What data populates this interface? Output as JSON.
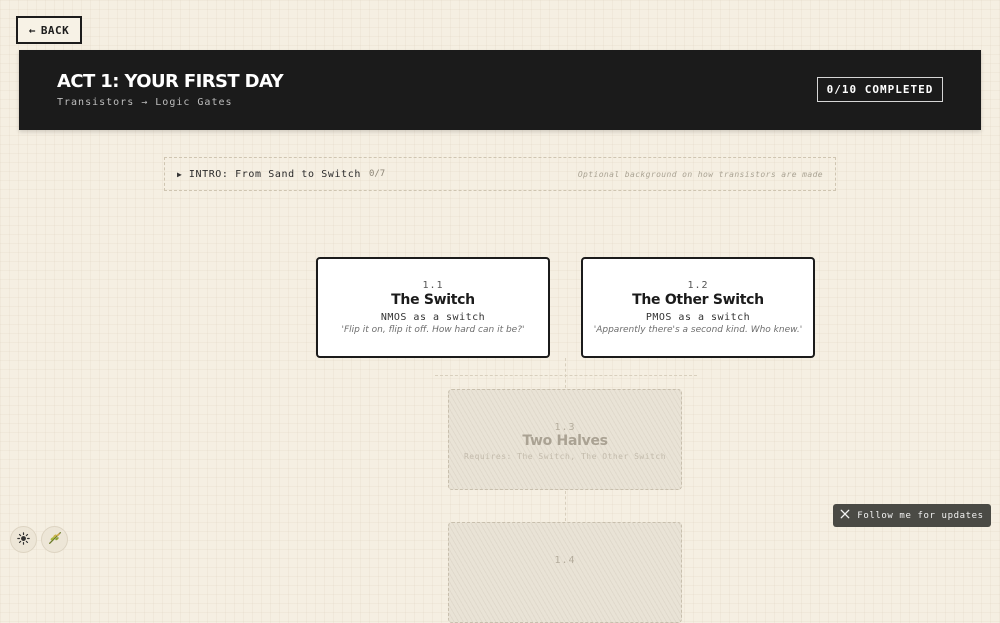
{
  "nav": {
    "back_label": "BACK",
    "back_arrow": "←"
  },
  "header": {
    "title": "ACT 1: YOUR FIRST DAY",
    "subtitle": "Transistors → Logic Gates",
    "progress": "0/10 COMPLETED"
  },
  "intro": {
    "caret": "▶",
    "title": "INTRO: From Sand to Switch",
    "count": "0/7",
    "note": "Optional background on how transistors are made"
  },
  "lessons": [
    {
      "number": "1.1",
      "title": "The Switch",
      "description": "NMOS as a switch",
      "quote": "'Flip it on, flip it off. How hard can it be?'",
      "status": "unlocked"
    },
    {
      "number": "1.2",
      "title": "The Other Switch",
      "description": "PMOS as a switch",
      "quote": "'Apparently there's a second kind. Who knew.'",
      "status": "unlocked"
    },
    {
      "number": "1.3",
      "title": "Two Halves",
      "requirement": "Requires: The Switch, The Other Switch",
      "status": "locked"
    },
    {
      "number": "1.4",
      "status": "locked"
    }
  ],
  "footer": {
    "follow_label": "Follow me for updates"
  },
  "icons": {
    "theme": "sun-icon",
    "decor": "plant-icon",
    "social": "x-logo-icon"
  },
  "colors": {
    "background": "#f5efe2",
    "header_bg": "#1b1b1b",
    "card_bg": "#ffffff",
    "locked_bg": "#e9e3d6",
    "follow_bg": "#4a4a45"
  }
}
